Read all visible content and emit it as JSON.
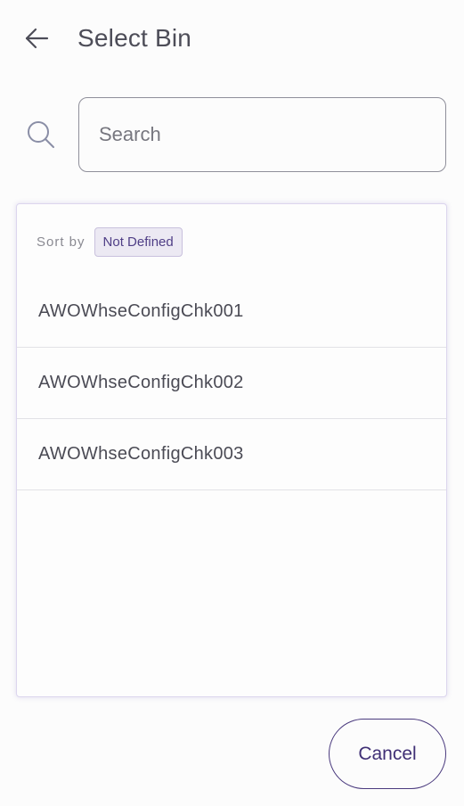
{
  "header": {
    "title": "Select Bin",
    "back_icon": "arrow-left-icon"
  },
  "search": {
    "icon": "search-icon",
    "placeholder": "Search",
    "value": ""
  },
  "sort": {
    "label": "Sort by",
    "selected": "Not Defined"
  },
  "bins": [
    {
      "name": "AWOWhseConfigChk001"
    },
    {
      "name": "AWOWhseConfigChk002"
    },
    {
      "name": "AWOWhseConfigChk003"
    }
  ],
  "footer": {
    "cancel_label": "Cancel"
  },
  "colors": {
    "accent": "#4f3e86",
    "chip_bg": "#ece9f3",
    "panel_border": "#dcd6ee"
  }
}
